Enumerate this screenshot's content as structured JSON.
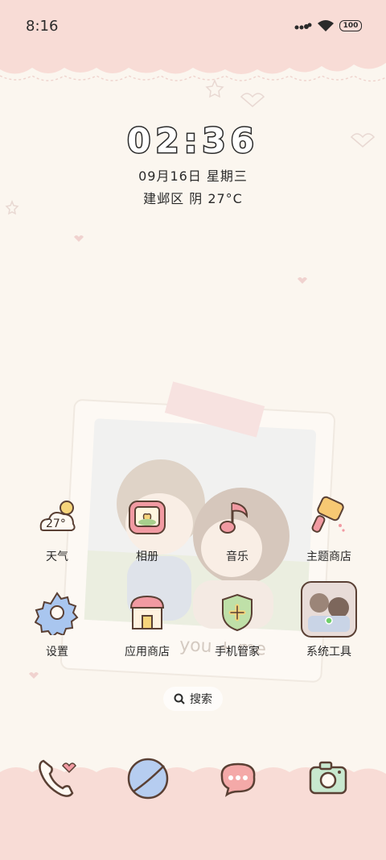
{
  "status_bar": {
    "time": "8:16",
    "battery": "100"
  },
  "clock": {
    "time": "02:36",
    "date": "09月16日 星期三",
    "weather": "建邺区 阴 27°C"
  },
  "apps": [
    {
      "label": "天气",
      "icon": "weather-icon",
      "temp": "27°"
    },
    {
      "label": "相册",
      "icon": "gallery-icon"
    },
    {
      "label": "音乐",
      "icon": "music-icon"
    },
    {
      "label": "主题商店",
      "icon": "theme-store-icon"
    },
    {
      "label": "设置",
      "icon": "settings-icon"
    },
    {
      "label": "应用商店",
      "icon": "app-store-icon"
    },
    {
      "label": "手机管家",
      "icon": "phone-manager-icon"
    },
    {
      "label": "系统工具",
      "icon": "system-tools-icon"
    }
  ],
  "search": {
    "label": "搜索"
  },
  "dock": [
    {
      "icon": "phone-icon"
    },
    {
      "icon": "browser-icon"
    },
    {
      "icon": "messages-icon"
    },
    {
      "icon": "camera-icon"
    }
  ],
  "wallpaper": {
    "caption": "you + me"
  },
  "colors": {
    "background": "#fbf6ef",
    "pink": "#f3c9c9",
    "outline": "#6b4a3a"
  }
}
